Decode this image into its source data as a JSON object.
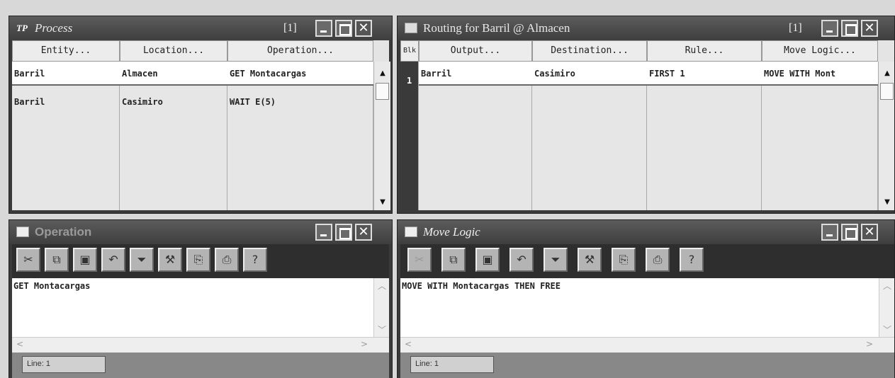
{
  "process": {
    "icon": "TP",
    "title": "Process",
    "count": "[1]",
    "columns": [
      "Entity...",
      "Location...",
      "Operation..."
    ],
    "rows": [
      [
        "Barril",
        "Almacen",
        "GET Montacargas"
      ],
      [
        "Barril",
        "Casimiro",
        "WAIT E(5)"
      ]
    ]
  },
  "routing": {
    "title": "Routing for Barril @ Almacen",
    "count": "[1]",
    "columns": [
      "Blk",
      "Output...",
      "Destination...",
      "Rule...",
      "Move Logic..."
    ],
    "rows": [
      [
        "1",
        "Barril",
        "Casimiro",
        "FIRST 1",
        "MOVE WITH Mont"
      ]
    ]
  },
  "operation": {
    "title": "Operation",
    "code": "GET Montacargas",
    "status": "Line: 1"
  },
  "move_logic": {
    "title": "Move Logic",
    "code": "MOVE WITH Montacargas THEN FREE",
    "status": "Line: 1"
  },
  "toolbar_icons": [
    "cut-icon",
    "copy-icon",
    "paste-icon",
    "undo-icon",
    "filter-icon",
    "build-icon",
    "insert-icon",
    "print-icon",
    "help-icon"
  ]
}
